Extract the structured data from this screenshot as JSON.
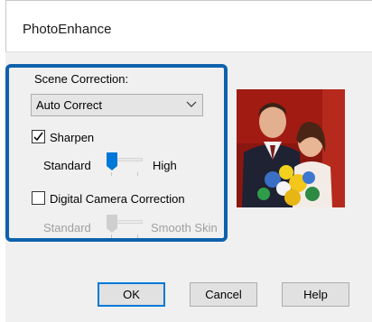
{
  "dialog": {
    "title": "PhotoEnhance"
  },
  "scene": {
    "label": "Scene Correction:",
    "selected": "Auto Correct"
  },
  "sharpen": {
    "label": "Sharpen",
    "checked": true,
    "low_label": "Standard",
    "high_label": "High",
    "level": 0
  },
  "digital_camera": {
    "label": "Digital Camera Correction",
    "checked": false,
    "low_label": "Standard",
    "high_label": "Smooth Skin",
    "level": 0,
    "enabled": false
  },
  "buttons": {
    "ok": "OK",
    "cancel": "Cancel",
    "help": "Help"
  },
  "colors": {
    "accent": "#0e62ad",
    "slider_thumb": "#0078d7",
    "disabled": "#a0a0a0"
  }
}
